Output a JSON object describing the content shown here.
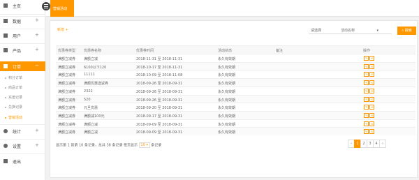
{
  "sidebar": {
    "items": [
      {
        "label": "主页"
      },
      {
        "label": "数据"
      },
      {
        "label": "用户"
      },
      {
        "label": "产品"
      },
      {
        "label": "订单"
      },
      {
        "label": "统计"
      },
      {
        "label": "设置"
      },
      {
        "label": "退出"
      }
    ],
    "sub_items": [
      {
        "label": "积分订单"
      },
      {
        "label": "商品订单"
      },
      {
        "label": "充值记录"
      },
      {
        "label": "兑换记录"
      },
      {
        "label": "营销活动"
      }
    ],
    "accent_color": "#ff9800"
  },
  "topbar": {
    "active_tab": "营销活动"
  },
  "toolbar": {
    "add_label": "新增 +",
    "select_value": "请选择",
    "search_placeholder": "活动名称",
    "search_label": "搜索"
  },
  "table": {
    "headers": [
      "优惠券类型",
      "优惠券名称",
      "优惠券时间",
      "活动状态",
      "备注",
      "操作"
    ],
    "rows": [
      [
        "满额立减券",
        "满额立减",
        "2018-11-31 至 2018-11-31",
        "永久有效期",
        ""
      ],
      [
        "满额立减券",
        "6100以下120",
        "2018-10-17 至 2018-11-31",
        "永久有效期",
        ""
      ],
      [
        "满额立减券",
        "11111",
        "2018-10-09 至 2018-11-08",
        "永久有效期",
        ""
      ],
      [
        "满额立减券",
        "满额优惠送返券",
        "2018-09-26 至 2018-09-31",
        "永久有效期",
        ""
      ],
      [
        "满额立减券",
        "2322",
        "2018-09-26 至 2018-09-31",
        "永久有效期",
        ""
      ],
      [
        "满额立减券",
        "520",
        "2018-09-26 至 2018-09-31",
        "永久有效期",
        ""
      ],
      [
        "满额立减券",
        "元旦优惠",
        "2018-09-20 至 2018-09-31",
        "永久有效期",
        ""
      ],
      [
        "满额立减券",
        "满额减100元",
        "2018-09-17 至 2018-09-31",
        "永久有效期",
        ""
      ],
      [
        "满额立减券",
        "满额立减",
        "2018-09-09 至 2018-09-31",
        "永久有效期",
        ""
      ],
      [
        "满额立减券",
        "满额立减",
        "2018-09-09 至 2018-09-31",
        "永久有效期",
        ""
      ]
    ]
  },
  "footer": {
    "summary_prefix": "显示第 1 到第 10 条记录，总共 38 条记录 每页显示",
    "page_size": "10",
    "summary_suffix": "条记录",
    "pages": [
      "‹",
      "1",
      "2",
      "3",
      "4",
      "›"
    ],
    "current_page": "1"
  }
}
